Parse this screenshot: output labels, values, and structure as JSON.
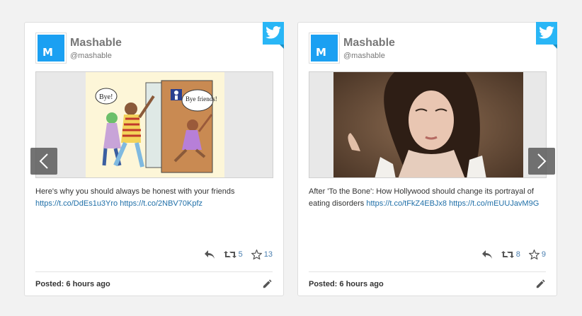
{
  "cards": [
    {
      "account": {
        "name": "Mashable",
        "handle": "@mashable",
        "avatar_letter": "M"
      },
      "media": {
        "description_icon": "comic-illustration",
        "bubble1": "Bye!",
        "bubble2": "Bye friends!"
      },
      "text": "Here's why you should always be honest with your friends",
      "links": [
        "https://t.co/DdEs1u3Yro",
        "https://t.co/2NBV70Kpfz"
      ],
      "retweets": "5",
      "likes": "13",
      "posted": "Posted: 6 hours ago"
    },
    {
      "account": {
        "name": "Mashable",
        "handle": "@mashable",
        "avatar_letter": "M"
      },
      "media": {
        "description_icon": "photo-woman-on-ground"
      },
      "text": "After 'To the Bone': How Hollywood should change its portrayal of eating disorders",
      "links": [
        "https://t.co/tFkZ4EBJx8",
        "https://t.co/mEUUJavM9G"
      ],
      "retweets": "8",
      "likes": "9",
      "posted": "Posted: 6 hours ago"
    }
  ],
  "colors": {
    "twitter": "#29b6f6",
    "link": "#1f6fa8",
    "avatar": "#1ba0f2"
  }
}
